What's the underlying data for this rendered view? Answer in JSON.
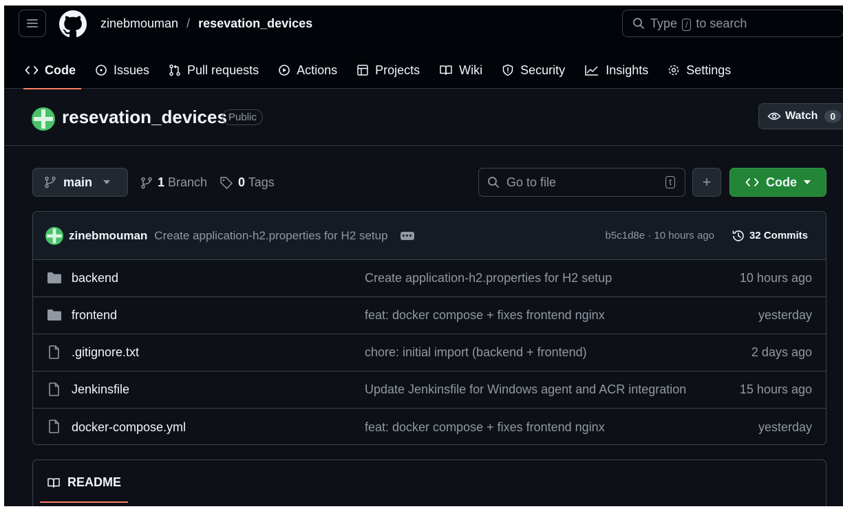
{
  "header": {
    "owner": "zinebmouman",
    "separator": "/",
    "repo": "resevation_devices",
    "search": {
      "prefix": "Type",
      "key": "/",
      "suffix": "to search"
    }
  },
  "tabs": [
    {
      "label": "Code",
      "icon": "code-icon"
    },
    {
      "label": "Issues",
      "icon": "issue-icon"
    },
    {
      "label": "Pull requests",
      "icon": "pull-request-icon"
    },
    {
      "label": "Actions",
      "icon": "play-icon"
    },
    {
      "label": "Projects",
      "icon": "table-icon"
    },
    {
      "label": "Wiki",
      "icon": "book-icon"
    },
    {
      "label": "Security",
      "icon": "shield-icon"
    },
    {
      "label": "Insights",
      "icon": "graph-icon"
    },
    {
      "label": "Settings",
      "icon": "gear-icon"
    }
  ],
  "repo_header": {
    "name": "resevation_devices",
    "visibility": "Public",
    "watch_label": "Watch",
    "watch_count": "0"
  },
  "toolbar": {
    "branch": "main",
    "branches_count": "1",
    "branches_label": "Branch",
    "tags_count": "0",
    "tags_label": "Tags",
    "goto_placeholder": "Go to file",
    "goto_key": "t",
    "plus_label": "+",
    "code_label": "Code"
  },
  "latest_commit": {
    "author": "zinebmouman",
    "message": "Create application-h2.properties for H2 setup",
    "hash_time": "b5c1d8e · 10 hours ago",
    "commits_label": "32 Commits"
  },
  "files": [
    {
      "type": "folder",
      "name": "backend",
      "message": "Create application-h2.properties for H2 setup",
      "date": "10 hours ago"
    },
    {
      "type": "folder",
      "name": "frontend",
      "message": "feat: docker compose + fixes frontend nginx",
      "date": "yesterday"
    },
    {
      "type": "file",
      "name": ".gitignore.txt",
      "message": "chore: initial import (backend + frontend)",
      "date": "2 days ago"
    },
    {
      "type": "file",
      "name": "Jenkinsfile",
      "message": "Update Jenkinsfile for Windows agent and ACR integration",
      "date": "15 hours ago"
    },
    {
      "type": "file",
      "name": "docker-compose.yml",
      "message": "feat: docker compose + fixes frontend nginx",
      "date": "yesterday"
    }
  ],
  "readme": {
    "label": "README"
  },
  "colors": {
    "background": "#0d1117",
    "header_bg": "#010409",
    "border": "#3d444d",
    "text": "#f0f6fc",
    "muted": "#9198a1",
    "accent_underline": "#f78166",
    "primary_button": "#238636",
    "avatar_green": "#4ac26b"
  }
}
